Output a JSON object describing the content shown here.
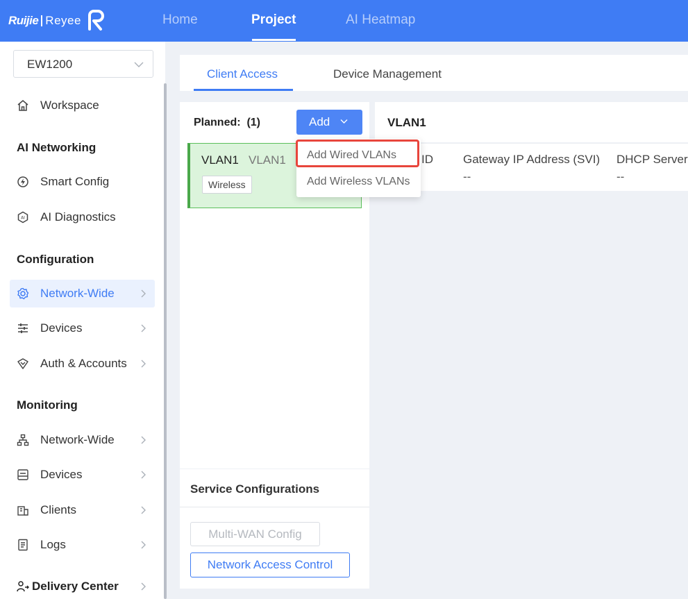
{
  "header": {
    "brand_primary": "Ruijie",
    "brand_secondary": "Reyee",
    "nav": [
      {
        "label": "Home"
      },
      {
        "label": "Project"
      },
      {
        "label": "AI Heatmap"
      }
    ],
    "active_nav": "Project",
    "bar_color": "#3f7cf4"
  },
  "sidebar": {
    "device_select_value": "EW1200",
    "workspace": {
      "label": "Workspace",
      "icon": "home-icon"
    },
    "sections": [
      {
        "title": "AI Networking",
        "items": [
          {
            "label": "Smart Config",
            "icon": "smart-config-icon"
          },
          {
            "label": "AI Diagnostics",
            "icon": "ai-diagnostics-icon"
          }
        ]
      },
      {
        "title": "Configuration",
        "items": [
          {
            "label": "Network-Wide",
            "icon": "gear-icon"
          },
          {
            "label": "Devices",
            "icon": "sliders-icon"
          },
          {
            "label": "Auth & Accounts",
            "icon": "shield-icon"
          }
        ]
      },
      {
        "title": "Monitoring",
        "items": [
          {
            "label": "Network-Wide",
            "icon": "topology-icon"
          },
          {
            "label": "Devices",
            "icon": "device-icon"
          },
          {
            "label": "Clients",
            "icon": "clients-icon"
          },
          {
            "label": "Logs",
            "icon": "logs-icon"
          }
        ]
      }
    ],
    "delivery_center": "Delivery Center",
    "active_item": "Network-Wide"
  },
  "tabs": [
    {
      "label": "Client Access"
    },
    {
      "label": "Device Management"
    }
  ],
  "vlan_panel": {
    "planned_label": "Planned:",
    "planned_count": "(1)",
    "add_button_label": "Add",
    "vlans": [
      {
        "name": "VLAN1",
        "sub": "VLAN1",
        "tag": "Wireless"
      }
    ]
  },
  "add_menu": {
    "items": [
      "Add Wired VLANs",
      "Add Wireless VLANs"
    ],
    "highlighted": "Add Wired VLANs"
  },
  "detail": {
    "title": "VLAN1",
    "columns": [
      "ID",
      "Gateway IP Address (SVI)",
      "DHCP Server"
    ],
    "values": [
      "--",
      "--"
    ]
  },
  "service": {
    "title": "Service Configurations",
    "buttons": [
      {
        "label": "Multi-WAN Config",
        "enabled": false
      },
      {
        "label": "Network Access Control",
        "enabled": true
      }
    ]
  }
}
